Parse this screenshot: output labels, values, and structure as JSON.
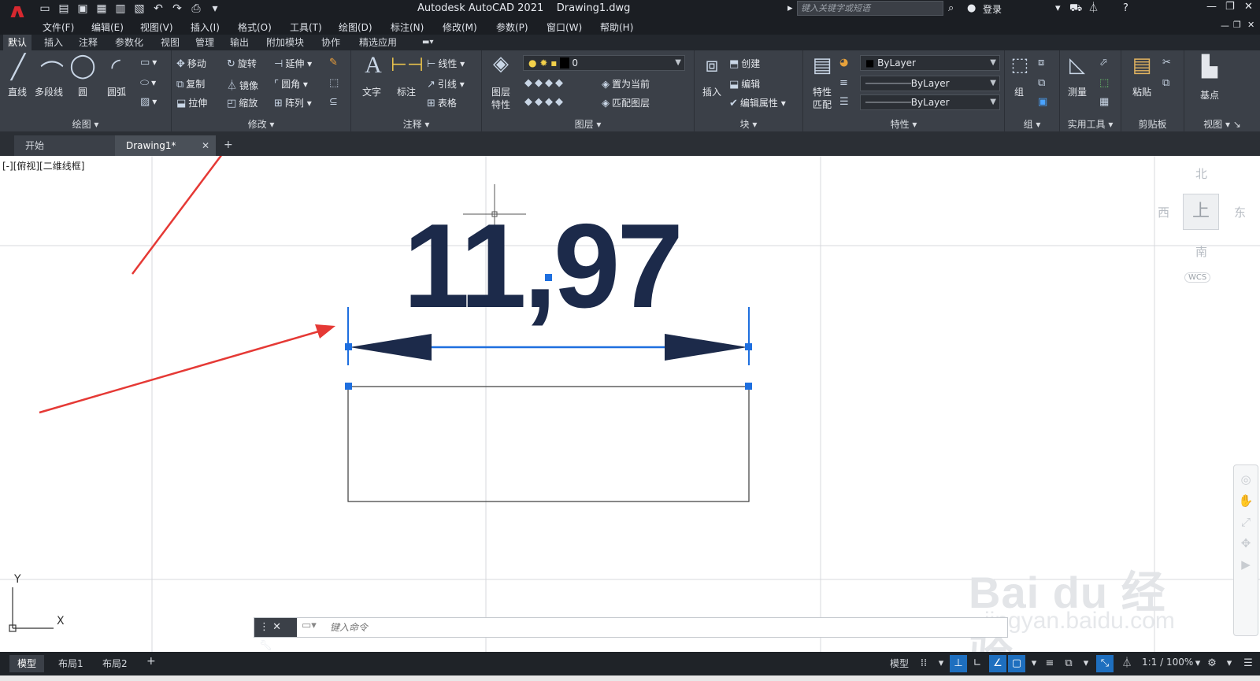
{
  "titlebar": {
    "title": "Autodesk AutoCAD 2021    Drawing1.dwg",
    "search_placeholder": "键入关键字或短语",
    "login": "登录",
    "logo": "A"
  },
  "menu": [
    "文件(F)",
    "编辑(E)",
    "视图(V)",
    "插入(I)",
    "格式(O)",
    "工具(T)",
    "绘图(D)",
    "标注(N)",
    "修改(M)",
    "参数(P)",
    "窗口(W)",
    "帮助(H)"
  ],
  "ribbon_tabs": [
    "默认",
    "插入",
    "注释",
    "参数化",
    "视图",
    "管理",
    "输出",
    "附加模块",
    "协作",
    "精选应用"
  ],
  "panels": {
    "draw": {
      "title": "绘图",
      "line": "直线",
      "polyline": "多段线",
      "circle": "圆",
      "arc": "圆弧"
    },
    "modify": {
      "title": "修改",
      "move": "移动",
      "rotate": "旋转",
      "trim": "延伸",
      "copy": "复制",
      "mirror": "镜像",
      "fillet": "圆角",
      "stretch": "拉伸",
      "scale": "缩放",
      "array": "阵列"
    },
    "annotation": {
      "title": "注释",
      "text": "文字",
      "dimension": "标注",
      "linear": "线性",
      "leader": "引线",
      "table": "表格"
    },
    "layers": {
      "title": "图层",
      "layer_properties_1": "图层",
      "layer_properties_2": "特性",
      "current_layer": "0",
      "make_current": "置为当前",
      "match_layer": "匹配图层"
    },
    "block": {
      "title": "块",
      "insert": "插入",
      "create": "创建",
      "edit": "编辑",
      "edit_attributes": "编辑属性"
    },
    "properties": {
      "title": "特性",
      "match_1": "特性",
      "match_2": "匹配",
      "color": "ByLayer",
      "linetype": "ByLayer",
      "lineweight": "ByLayer"
    },
    "groups": {
      "title": "组",
      "group": "组"
    },
    "utilities": {
      "title": "实用工具",
      "measure": "测量"
    },
    "clipboard": {
      "title": "剪贴板",
      "paste": "粘贴"
    },
    "view": {
      "title": "视图",
      "base": "基点"
    }
  },
  "doc_tabs": {
    "start": "开始",
    "drawing": "Drawing1*"
  },
  "canvas": {
    "viewport_label": "[-][俯视][二维线框]",
    "dimension_text": "11,97",
    "viewcube": {
      "north": "北",
      "south": "南",
      "east": "东",
      "west": "西",
      "face": "上",
      "wcs": "WCS"
    },
    "ucs_x": "X",
    "ucs_y": "Y"
  },
  "command_line": {
    "placeholder": "键入命令"
  },
  "watermark": {
    "brand": "Bai du 经验",
    "url": "jingyan.baidu.com"
  },
  "statusbar": {
    "layouts": [
      "模型",
      "布局1",
      "布局2"
    ],
    "model": "模型",
    "scale": "1:1 / 100%"
  },
  "colors": {
    "accent": "#1e6fbf",
    "annotation_arrow": "#e53935",
    "dimension": "#1c2a4a",
    "grip": "#1e6fdf"
  }
}
